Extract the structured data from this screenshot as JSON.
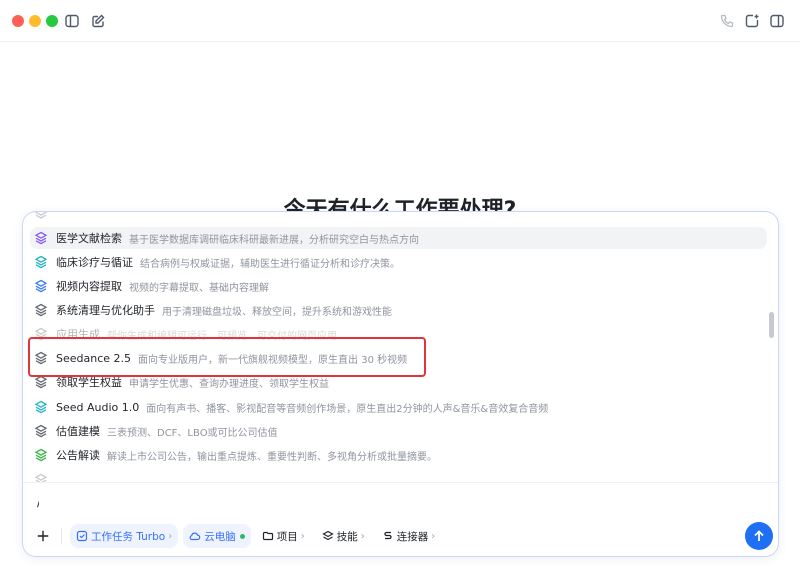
{
  "headline": "今天有什么工作要处理?",
  "titlebar": {
    "icons": [
      "sidebar-toggle-icon",
      "compose-icon",
      "phone-icon",
      "new-window-icon",
      "split-view-icon"
    ]
  },
  "skills": [
    {
      "name": "医学文献检索",
      "desc": "基于医学数据库调研临床科研最新进展，分析研究空白与热点方向",
      "icon_color": "#8a5cf6",
      "highlighted": true
    },
    {
      "name": "临床诊疗与循证",
      "desc": "结合病例与权威证据，辅助医生进行循证分析和诊疗决策。",
      "icon_color": "#22b5c7"
    },
    {
      "name": "视频内容提取",
      "desc": "视频的字幕提取、基础内容理解",
      "icon_color": "#3d7df5"
    },
    {
      "name": "系统清理与优化助手",
      "desc": "用于清理磁盘垃圾、释放空间，提升系统和游戏性能",
      "icon_color": "#646a73"
    },
    {
      "name": "应用生成",
      "desc": "帮你生成和编辑可运行、可预览、可交付的网页应用",
      "icon_color": "#646a73",
      "faded": true
    },
    {
      "name": "Seedance 2.5",
      "desc": "面向专业版用户，新一代旗舰视频模型，原生直出 30 秒视频",
      "icon_color": "#646a73"
    },
    {
      "name": "领取学生权益",
      "desc": "申请学生优惠、查询办理进度、领取学生权益",
      "icon_color": "#646a73"
    },
    {
      "name": "Seed Audio 1.0",
      "desc": "面向有声书、播客、影视配音等音频创作场景，原生直出2分钟的人声&音乐&音效复合音频",
      "icon_color": "#22b5c7"
    },
    {
      "name": "估值建模",
      "desc": "三表预测、DCF、LBO或可比公司估值",
      "icon_color": "#646a73"
    },
    {
      "name": "公告解读",
      "desc": "解读上市公司公告，输出重点提炼、重要性判断、多视角分析或批量摘要。",
      "icon_color": "#3bb34a"
    }
  ],
  "composer": {
    "input_value": "/",
    "chips": {
      "task": "工作任务 Turbo",
      "cloud": "云电脑",
      "project": "项目",
      "skills": "技能",
      "connector": "连接器"
    }
  },
  "colors": {
    "accent": "#3370ff",
    "send_button": "#1f6ff5",
    "annotation_box": "#e0353b"
  }
}
